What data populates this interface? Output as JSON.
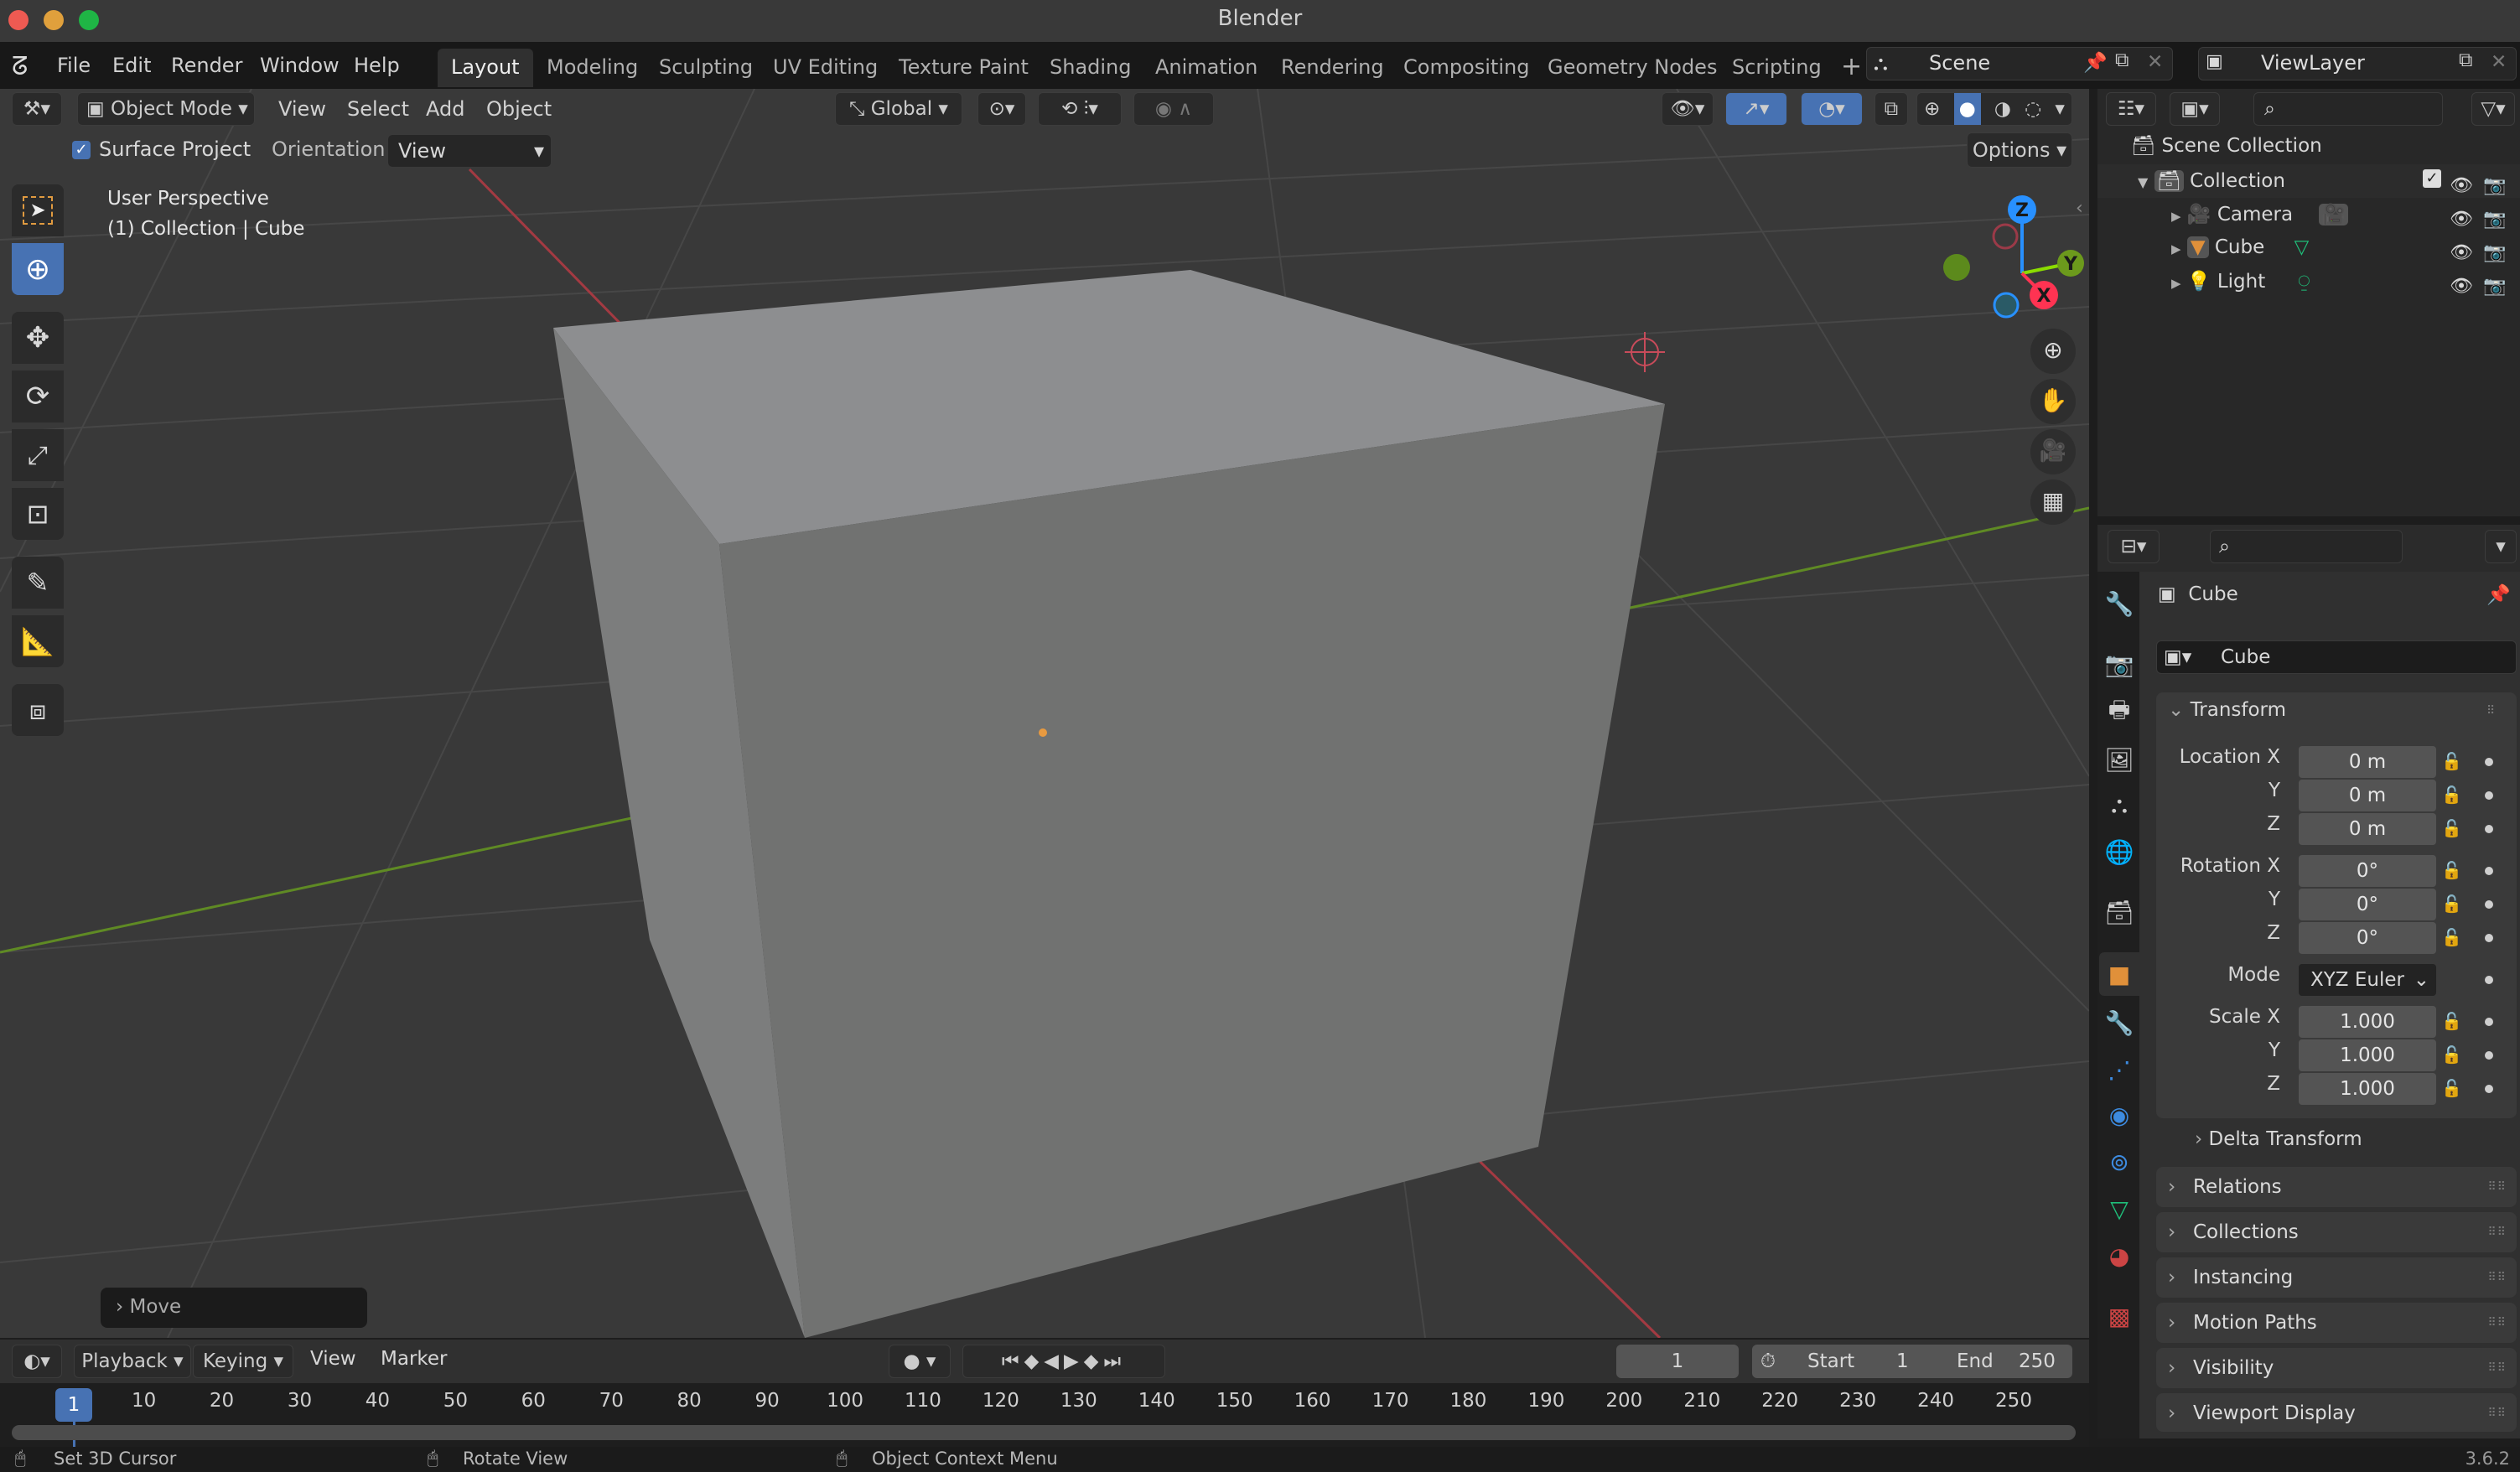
{
  "window": {
    "title": "Blender",
    "version": "3.6.2"
  },
  "menubar": {
    "items": [
      "File",
      "Edit",
      "Render",
      "Window",
      "Help"
    ]
  },
  "workspaces": {
    "tabs": [
      "Layout",
      "Modeling",
      "Sculpting",
      "UV Editing",
      "Texture Paint",
      "Shading",
      "Animation",
      "Rendering",
      "Compositing",
      "Geometry Nodes",
      "Scripting"
    ],
    "active": "Layout",
    "add_label": "+"
  },
  "scene": {
    "name": "Scene",
    "view_layer": "ViewLayer"
  },
  "viewport_header": {
    "mode": "Object Mode",
    "menus": [
      "View",
      "Select",
      "Add",
      "Object"
    ],
    "transform_orientation": "Global"
  },
  "tool_settings": {
    "surface_project_label": "Surface Project",
    "surface_project_checked": true,
    "orientation_label": "Orientation:",
    "orientation_value": "View",
    "options_label": "Options"
  },
  "viewport": {
    "view_name": "User Perspective",
    "context": "(1) Collection | Cube",
    "last_op": "Move",
    "gizmo": {
      "x": "X",
      "y": "Y",
      "z": "Z"
    },
    "colors": {
      "x_axis": "#ff3352",
      "y_axis": "#8bdc00",
      "z_axis": "#2890ff",
      "accent": "#4772b3"
    }
  },
  "toolbar": {
    "tools": [
      "select-box",
      "cursor",
      "move",
      "rotate",
      "scale",
      "transform",
      "annotate",
      "measure",
      "add-cube"
    ],
    "active": "cursor"
  },
  "outliner": {
    "root": "Scene Collection",
    "collection": "Collection",
    "objects": [
      {
        "name": "Camera",
        "type": "camera"
      },
      {
        "name": "Cube",
        "type": "mesh"
      },
      {
        "name": "Light",
        "type": "light"
      }
    ]
  },
  "properties": {
    "object_name": "Cube",
    "datablock_name": "Cube",
    "transform": {
      "title": "Transform",
      "location": {
        "label": "Location X",
        "x": "0 m",
        "y": "0 m",
        "z": "0 m"
      },
      "rotation": {
        "label": "Rotation X",
        "x": "0°",
        "y": "0°",
        "z": "0°"
      },
      "mode_label": "Mode",
      "mode_value": "XYZ Euler",
      "scale": {
        "label": "Scale X",
        "x": "1.000",
        "y": "1.000",
        "z": "1.000"
      },
      "axis_y": "Y",
      "axis_z": "Z",
      "delta": "Delta Transform"
    },
    "panels": [
      "Relations",
      "Collections",
      "Instancing",
      "Motion Paths",
      "Visibility",
      "Viewport Display"
    ]
  },
  "timeline": {
    "menus": {
      "playback": "Playback",
      "keying": "Keying",
      "view": "View",
      "marker": "Marker"
    },
    "current_frame": "1",
    "start_label": "Start",
    "start": "1",
    "end_label": "End",
    "end": "250",
    "ticks": [
      "10",
      "20",
      "30",
      "40",
      "50",
      "60",
      "70",
      "80",
      "90",
      "100",
      "110",
      "120",
      "130",
      "140",
      "150",
      "160",
      "170",
      "180",
      "190",
      "200",
      "210",
      "220",
      "230",
      "240",
      "250"
    ]
  },
  "statusbar": {
    "left": "Set 3D Cursor",
    "middle": "Rotate View",
    "right": "Object Context Menu"
  }
}
